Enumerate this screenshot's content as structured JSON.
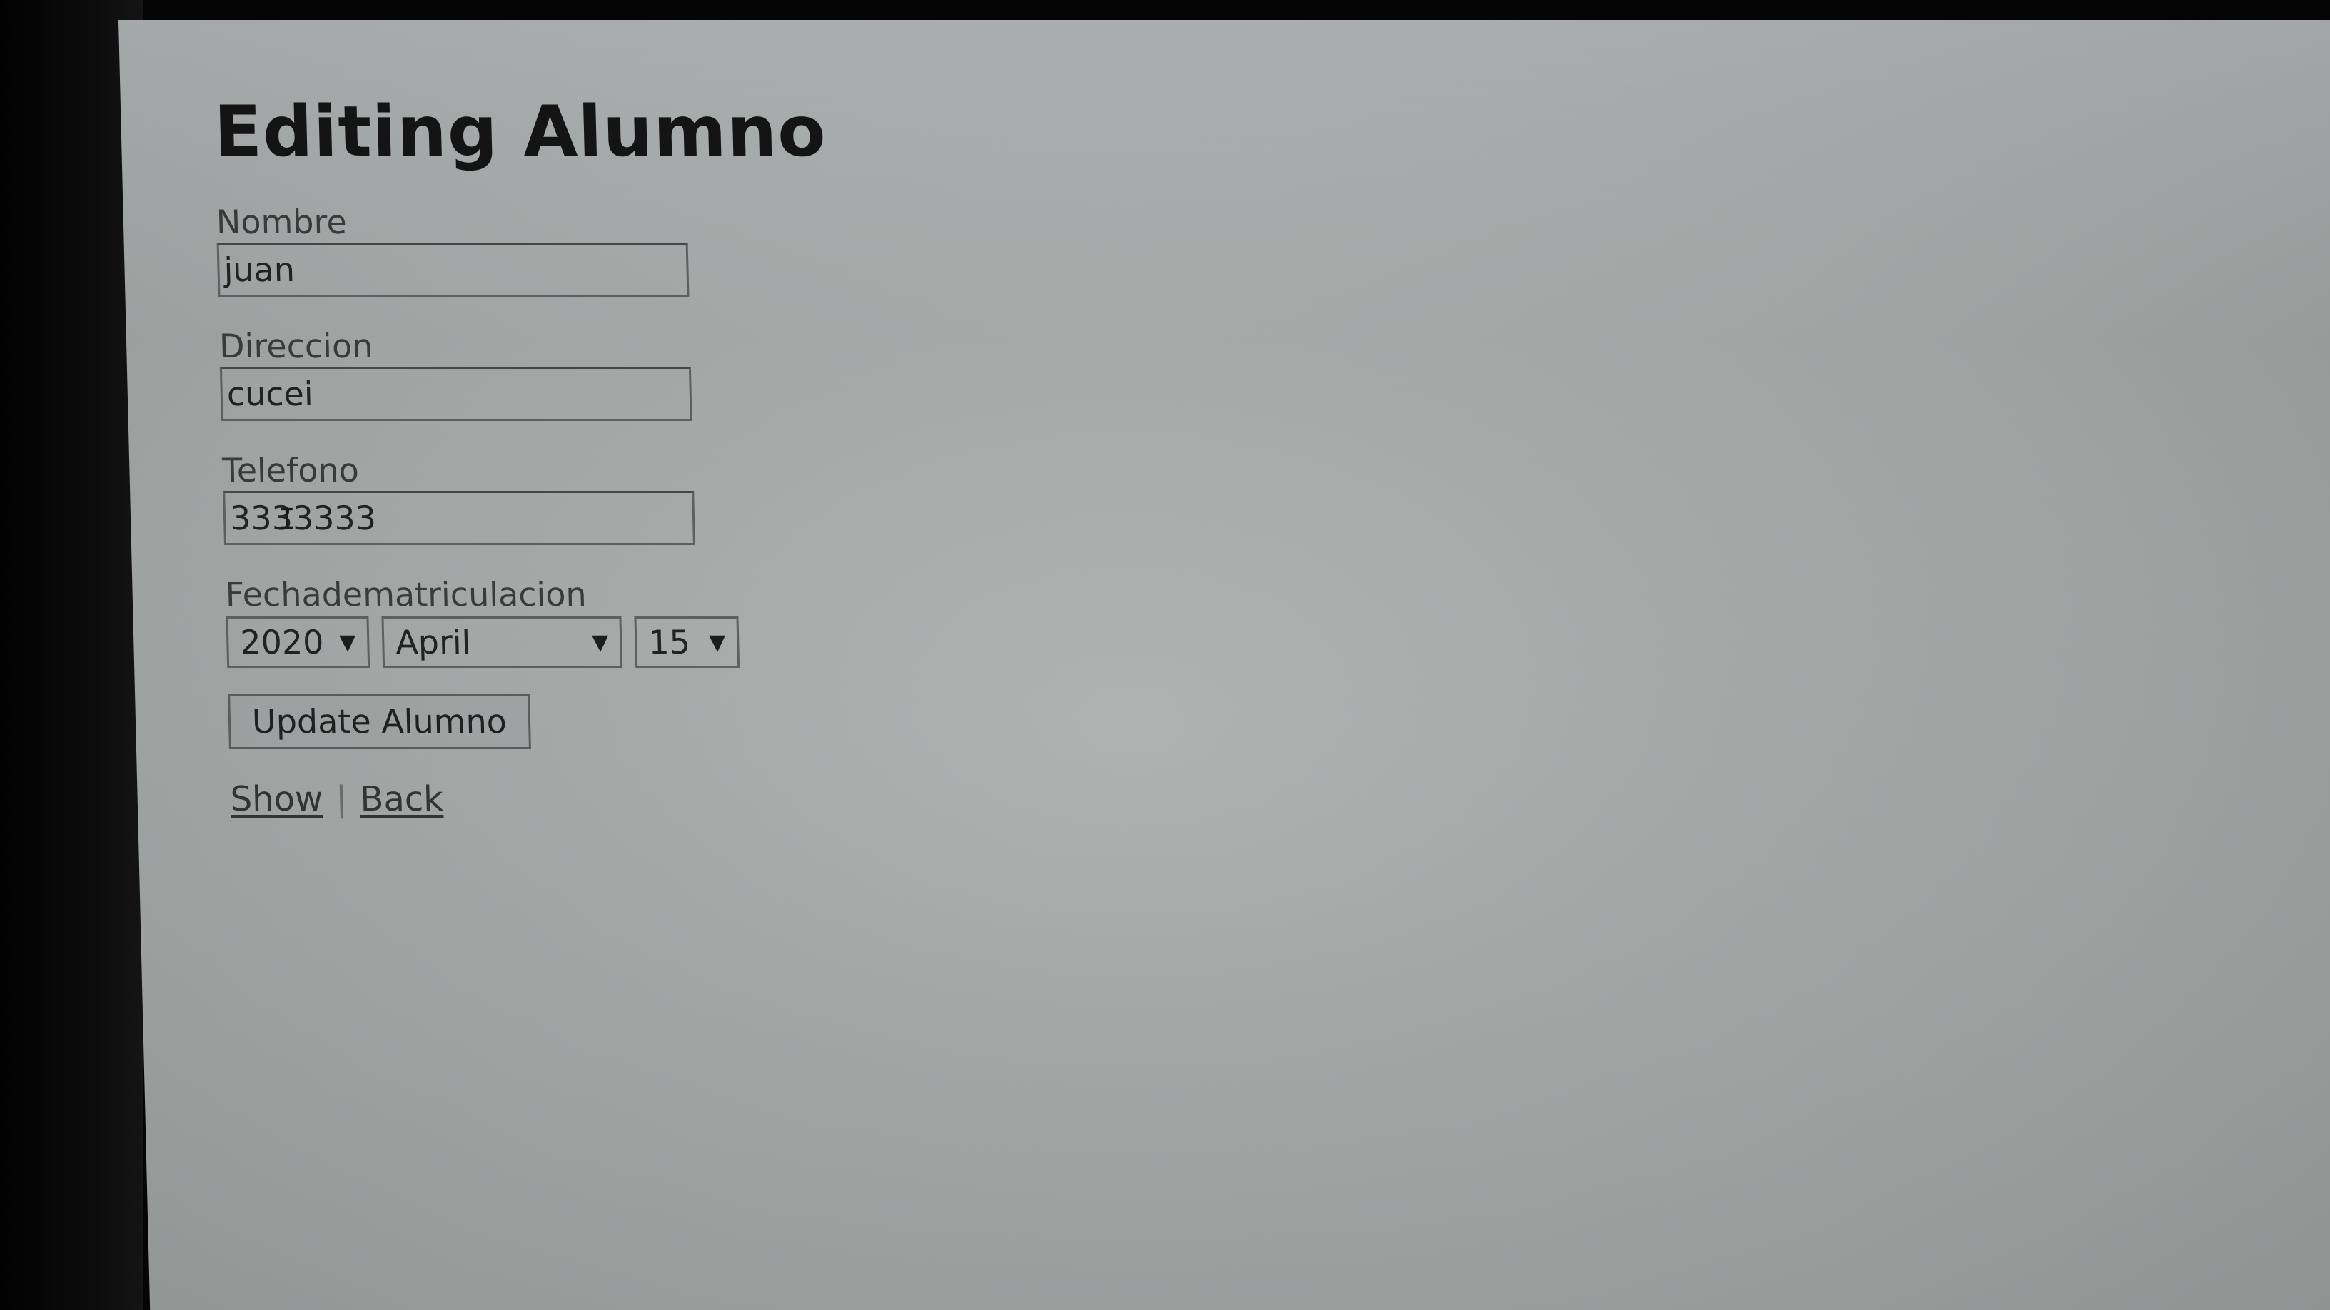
{
  "page": {
    "title": "Editing Alumno"
  },
  "form": {
    "nombre": {
      "label": "Nombre",
      "value": "juan"
    },
    "direccion": {
      "label": "Direccion",
      "value": "cucei"
    },
    "telefono": {
      "label": "Telefono",
      "value": "3333333"
    },
    "fecha": {
      "label": "Fechadematriculacion",
      "year": "2020",
      "month": "April",
      "day": "15",
      "arrow": "▼"
    },
    "submit_label": "Update Alumno"
  },
  "links": {
    "show": "Show",
    "separator": "|",
    "back": "Back"
  },
  "icons": {
    "text_cursor": "I"
  }
}
